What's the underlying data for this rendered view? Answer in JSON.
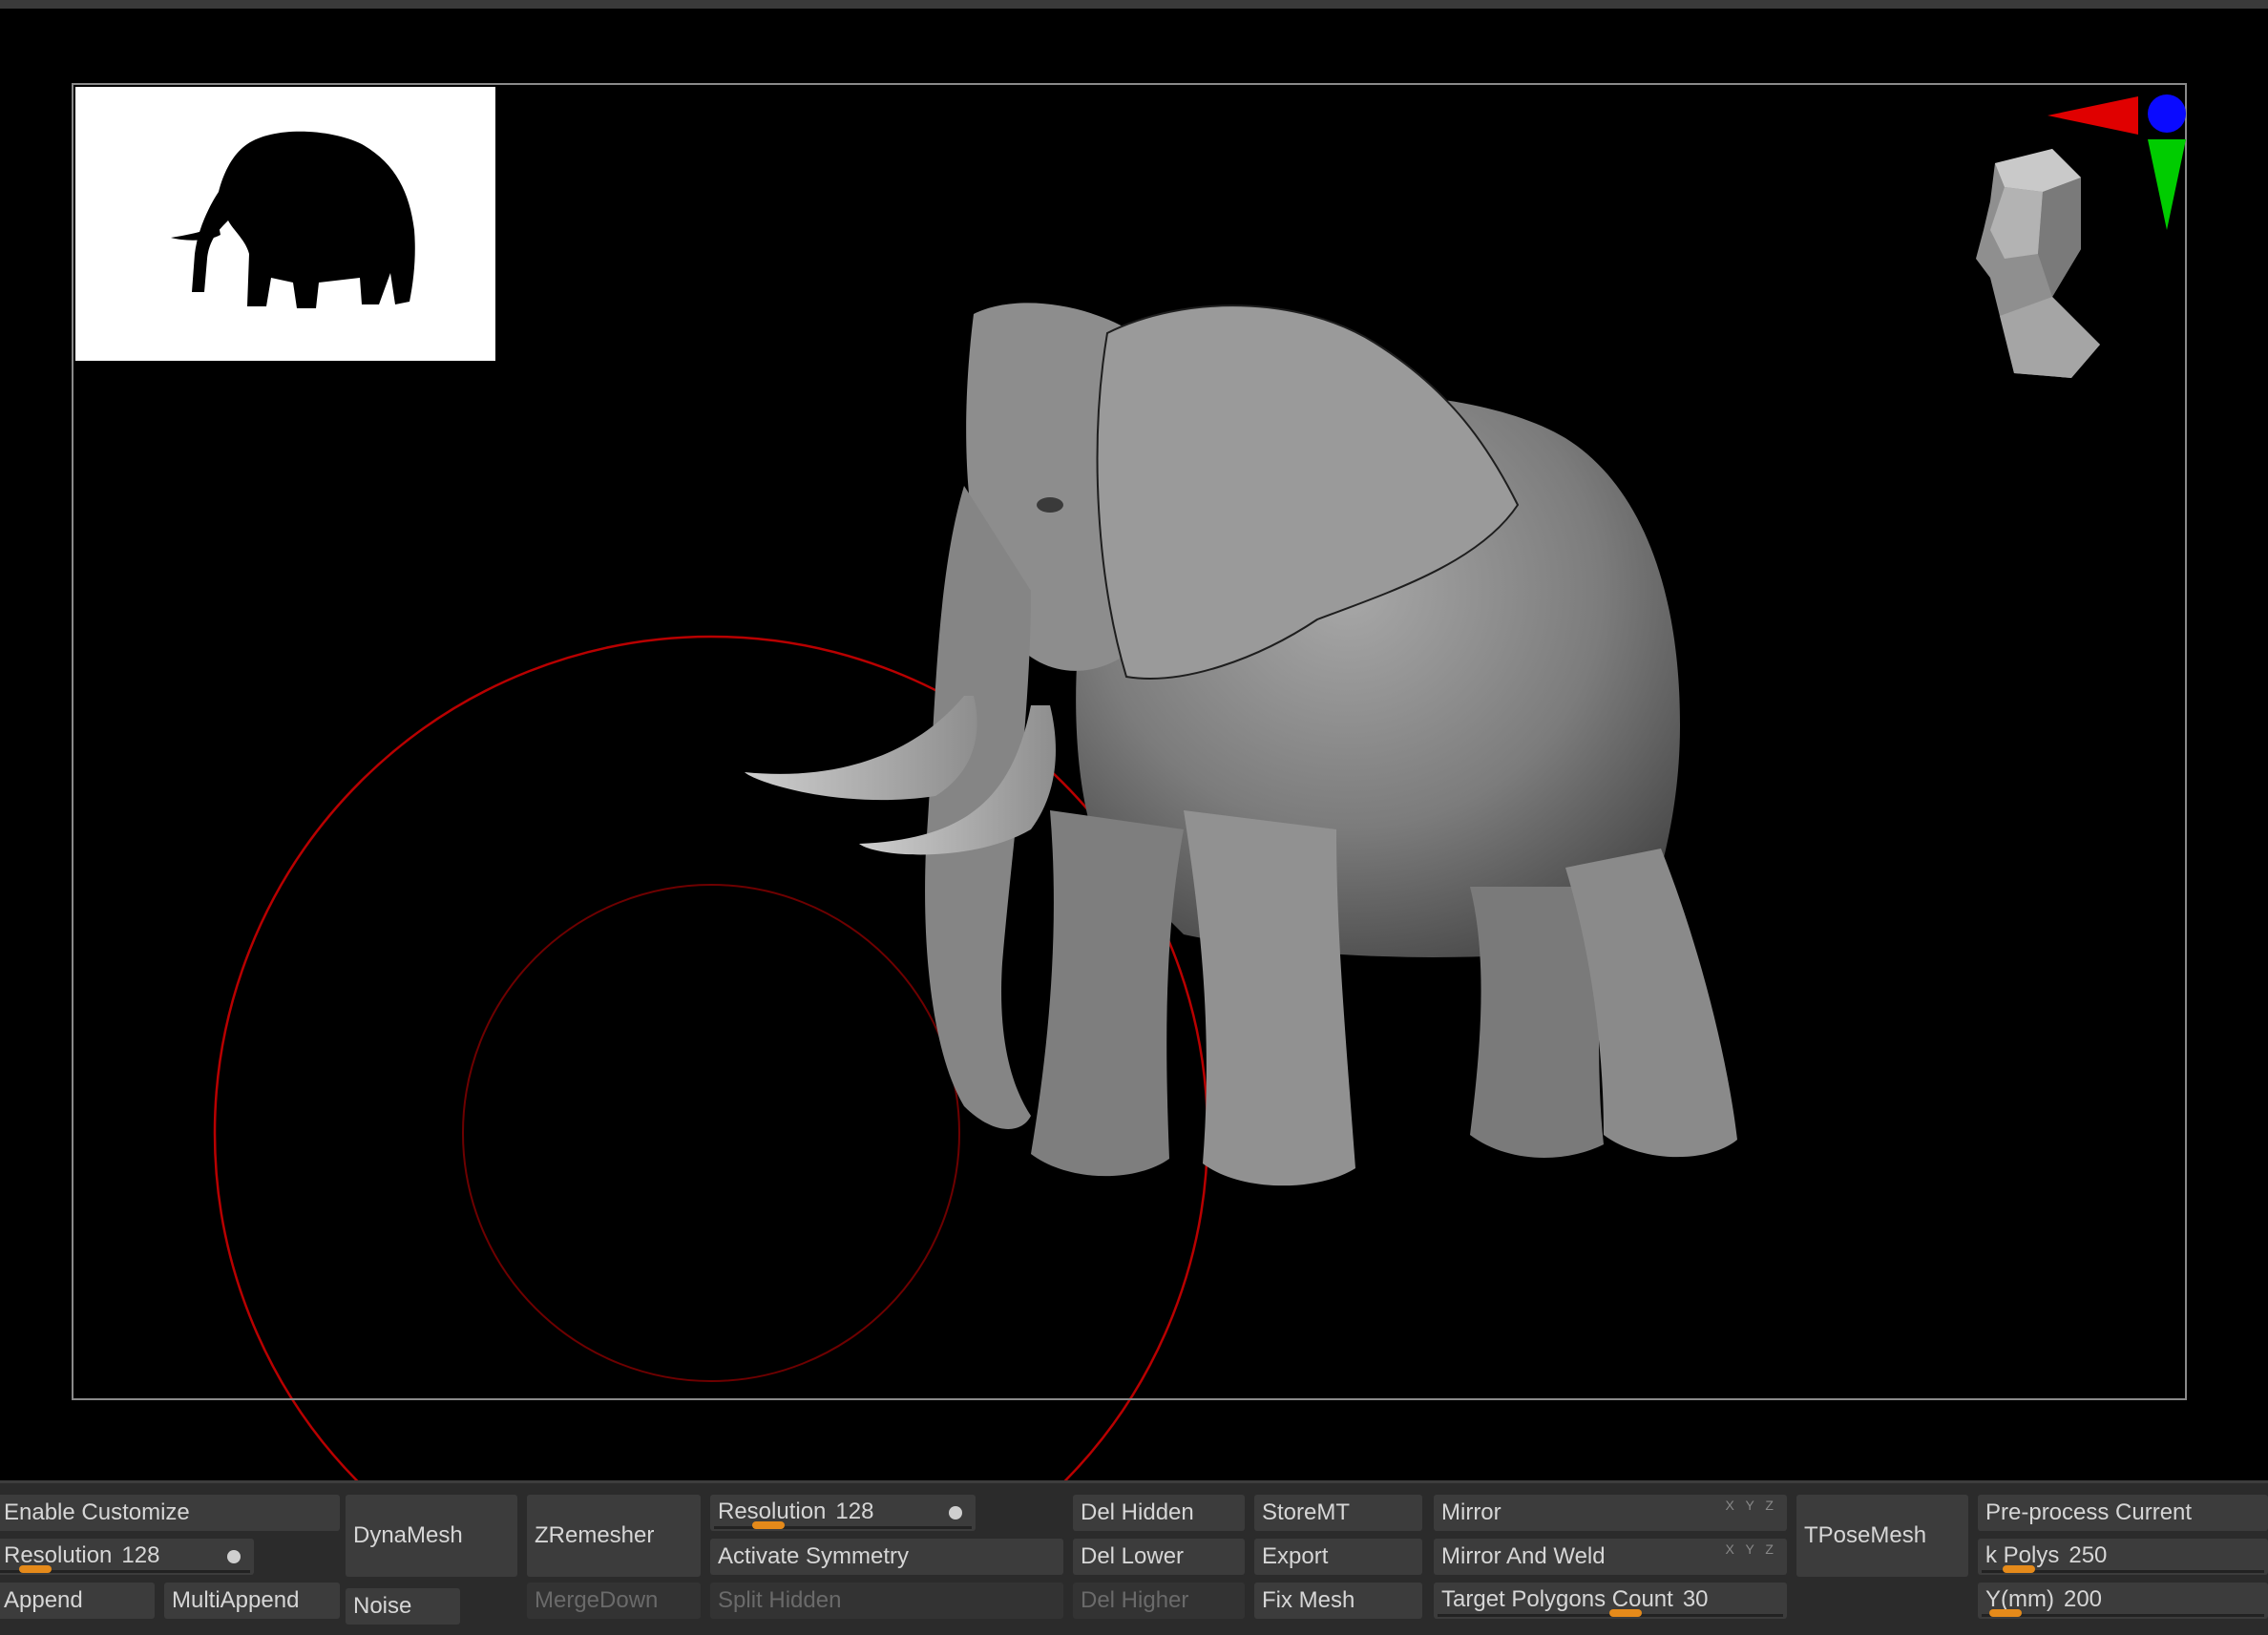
{
  "viewport": {
    "thumbnail": {
      "icon": "elephant-silhouette-icon"
    },
    "gizmo": {
      "icon": "head-navigation-icon",
      "axis_colors": {
        "x": "#e00000",
        "y": "#00cc00",
        "z": "#0a0aff"
      }
    },
    "model": {
      "icon": "elephant-sculpt-icon",
      "color": "#8c8c8c"
    },
    "brush_color": "#b80000"
  },
  "toolbar": {
    "enable_customize": "Enable Customize",
    "resolution_left": {
      "label": "Resolution",
      "value": "128",
      "level": 0.2
    },
    "append": "Append",
    "multiappend": "MultiAppend",
    "dynamesh": "DynaMesh",
    "noise": "Noise",
    "zremesher": "ZRemesher",
    "mergedown": "MergeDown",
    "resolution_mid": {
      "label": "Resolution",
      "value": "128",
      "level": 0.2
    },
    "activate_symmetry": "Activate Symmetry",
    "split_hidden": "Split Hidden",
    "del_hidden": "Del Hidden",
    "del_lower": "Del Lower",
    "del_higher": "Del Higher",
    "storemt": "StoreMT",
    "export": "Export",
    "fix_mesh": "Fix Mesh",
    "mirror": "Mirror",
    "mirror_and_weld": "Mirror And Weld",
    "target_polygons": {
      "label": "Target Polygons Count",
      "value": "30",
      "level": 0.5
    },
    "xyz_label": "X Y Z",
    "tposemesh": "TPoseMesh",
    "preprocess_current": "Pre-process Current",
    "k_polys": {
      "label": "k Polys",
      "value": "250",
      "level": 0.1
    },
    "y_mm": {
      "label": "Y(mm)",
      "value": "200",
      "level": 0.05
    }
  }
}
